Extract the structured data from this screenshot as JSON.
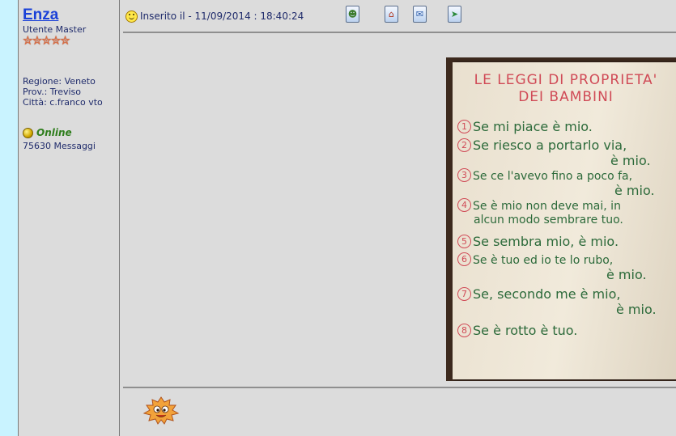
{
  "user": {
    "name": "Enza",
    "rank": "Utente Master",
    "stars": "✮✮✮✮✮",
    "region": "Regione: Veneto",
    "province": "Prov.: Treviso",
    "city": "Città: c.franco vto",
    "status": "Online",
    "messages": "75630 Messaggi"
  },
  "post": {
    "inserted": "Inserito il  -  11/09/2014 : 18:40:24",
    "icons": [
      "profile-icon",
      "homepage-icon",
      "email-icon",
      "reply-quote-icon"
    ],
    "image": {
      "title_line1": "LE LEGGI DI PROPRIETA'",
      "title_line2": "DEI BAMBINI",
      "rules": [
        {
          "num": "1",
          "text": "Se mi piace è mio."
        },
        {
          "num": "2",
          "text": "Se riesco a portarlo via,",
          "cont": "è mio."
        },
        {
          "num": "3",
          "text": "Se ce l'avevo fino a poco fa,",
          "cont": "è mio."
        },
        {
          "num": "4",
          "text": "Se è mio non deve mai, in",
          "cont": "alcun modo sembrare tuo."
        },
        {
          "num": "5",
          "text": "Se sembra mio, è mio."
        },
        {
          "num": "6",
          "text": "Se è tuo ed io te lo rubo,",
          "cont": "è mio."
        },
        {
          "num": "7",
          "text": "Se, secondo me è mio,",
          "cont": "è mio."
        },
        {
          "num": "8",
          "text": "Se è rotto è tuo."
        }
      ]
    }
  }
}
